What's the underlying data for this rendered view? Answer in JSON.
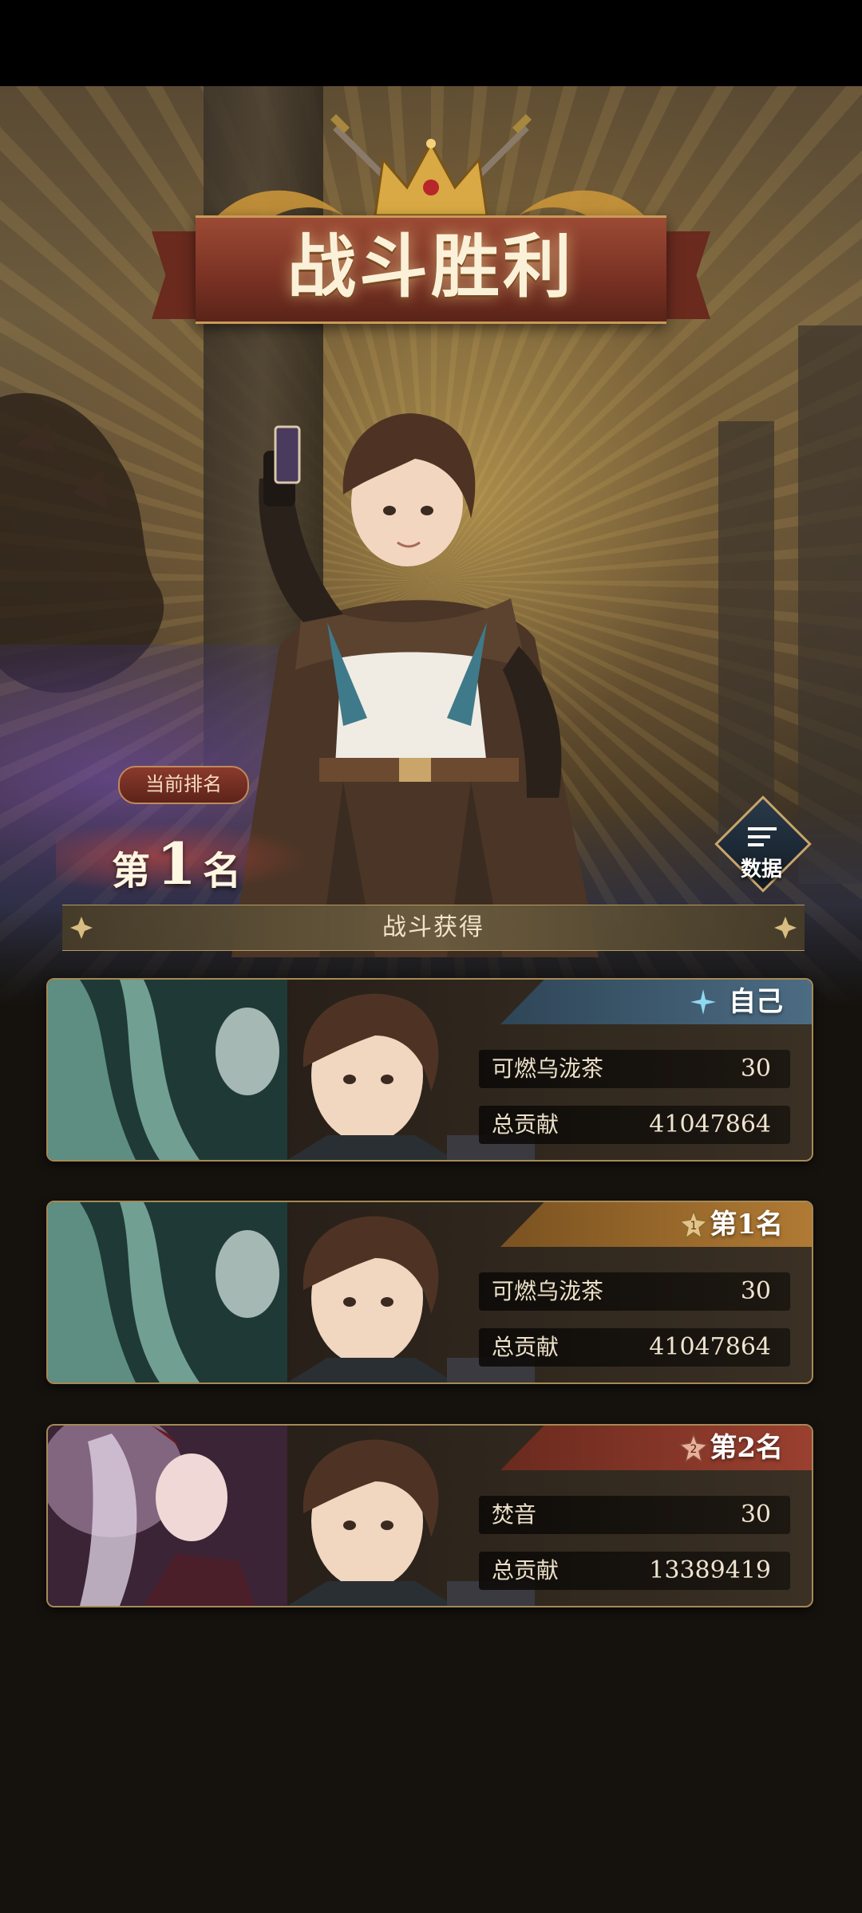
{
  "title": "战斗胜利",
  "rank": {
    "label": "当前排名",
    "prefix": "第",
    "number": "1",
    "suffix": "名"
  },
  "data_button": {
    "label": "数据",
    "icon": "menu-lines-icon"
  },
  "section": {
    "title": "战斗获得"
  },
  "colors": {
    "self_tag": "#3d5a70",
    "rank1_tag": "#9a6a2c",
    "rank2_tag": "#8a3a2a",
    "card_border": "#a78956"
  },
  "cards": [
    {
      "tag": "自己",
      "tag_icon": "sparkle-icon",
      "player": "可燃乌泷茶",
      "player_value": "30",
      "contrib_label": "总贡献",
      "contrib_value": "41047864"
    },
    {
      "tag": "第1名",
      "tag_icon": "rank-1-badge-icon",
      "badge": "1",
      "player": "可燃乌泷茶",
      "player_value": "30",
      "contrib_label": "总贡献",
      "contrib_value": "41047864"
    },
    {
      "tag": "第2名",
      "tag_icon": "rank-2-badge-icon",
      "badge": "2",
      "player": "焚音",
      "player_value": "30",
      "contrib_label": "总贡献",
      "contrib_value": "13389419"
    }
  ]
}
